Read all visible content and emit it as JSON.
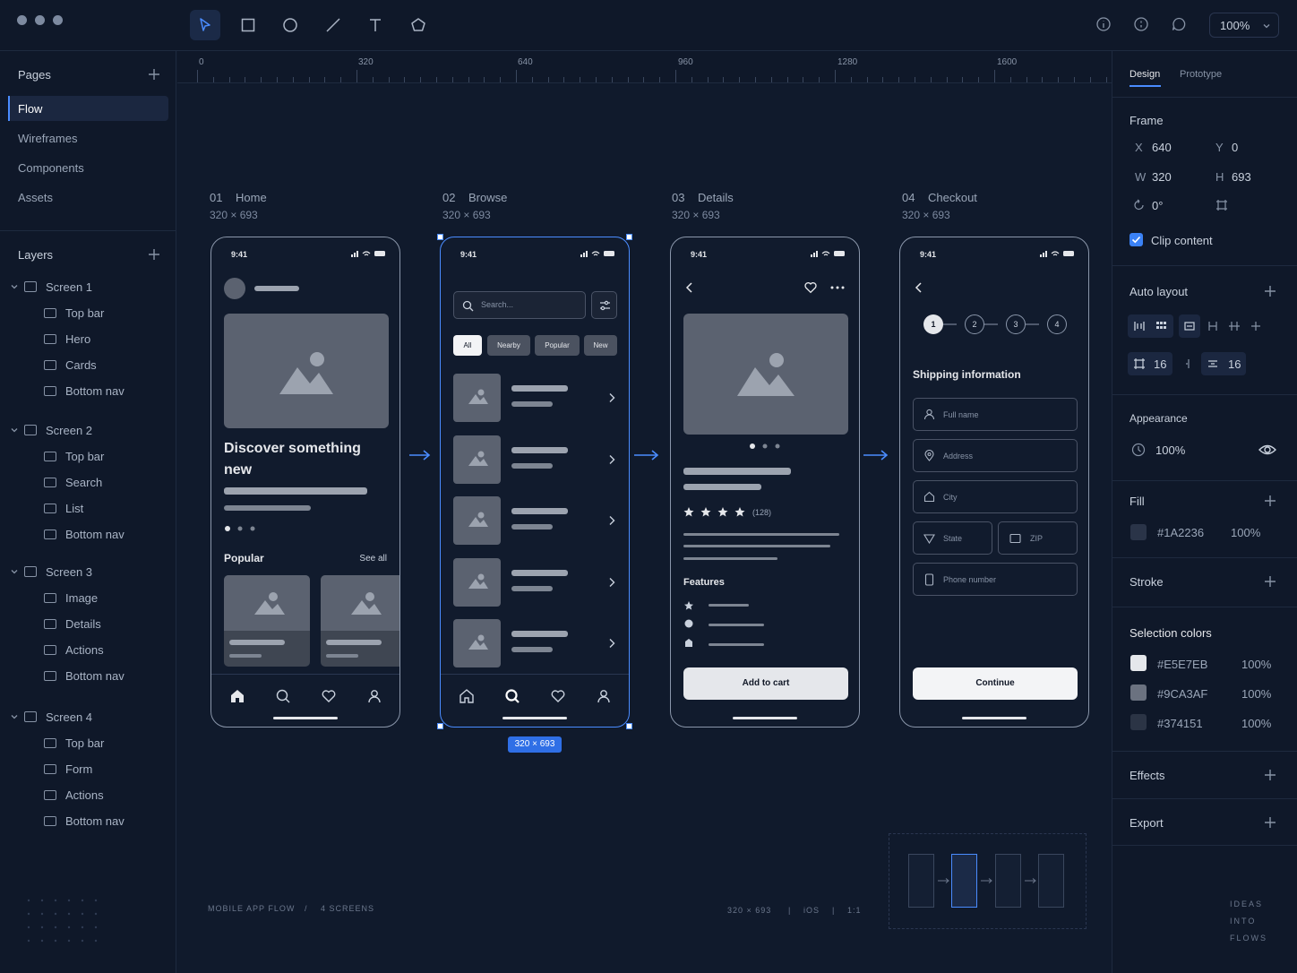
{
  "toolbar": {
    "tools": [
      "move-tool",
      "rectangle-tool",
      "ellipse-tool",
      "line-tool",
      "text-tool",
      "shape-tool"
    ],
    "zoom": "100%"
  },
  "pages": {
    "title": "Pages",
    "items": [
      "Flow",
      "Wireframes",
      "Components",
      "Assets"
    ],
    "active": "Flow"
  },
  "layers": {
    "title": "Layers",
    "screens": [
      {
        "name": "Screen 1",
        "children": [
          "Top bar",
          "Hero",
          "Cards",
          "Bottom nav"
        ]
      },
      {
        "name": "Screen 2",
        "children": [
          "Top bar",
          "Search",
          "List",
          "Bottom nav"
        ]
      },
      {
        "name": "Screen 3",
        "children": [
          "Image",
          "Details",
          "Actions",
          "Bottom nav"
        ]
      },
      {
        "name": "Screen 4",
        "children": [
          "Top bar",
          "Form",
          "Actions",
          "Bottom nav"
        ]
      }
    ]
  },
  "ruler": [
    "0",
    "320",
    "640",
    "960",
    "1280",
    "1600"
  ],
  "frames": [
    {
      "num": "01",
      "name": "Home",
      "dim": "320 × 693"
    },
    {
      "num": "02",
      "name": "Browse",
      "dim": "320 × 693"
    },
    {
      "num": "03",
      "name": "Details",
      "dim": "320 × 693"
    },
    {
      "num": "04",
      "name": "Checkout",
      "dim": "320 × 693"
    }
  ],
  "phone": {
    "time": "9:41",
    "home": {
      "headline": "Discover something new",
      "popular": "Popular",
      "see_all": "See all"
    },
    "browse": {
      "search_placeholder": "Search...",
      "chips": [
        "All",
        "Nearby",
        "Popular",
        "New"
      ],
      "selection_badge": "320 × 693"
    },
    "details": {
      "reviews": "(128)",
      "features": "Features",
      "cta": "Add to cart"
    },
    "checkout": {
      "steps": [
        "1",
        "2",
        "3",
        "4"
      ],
      "title": "Shipping information",
      "fields": {
        "full_name": "Full name",
        "address": "Address",
        "city": "City",
        "state": "State",
        "zip": "ZIP",
        "phone": "Phone number"
      },
      "cta": "Continue"
    }
  },
  "canvas_footer": {
    "left": "MOBILE APP FLOW",
    "sep": "/",
    "count": "4 SCREENS",
    "dim": "320 × 693",
    "platform": "iOS",
    "scale": "1:1",
    "bar": "|"
  },
  "brand": [
    "IDEAS",
    "INTO",
    "FLOWS"
  ],
  "inspector": {
    "tabs": [
      "Design",
      "Prototype"
    ],
    "frame": {
      "title": "Frame",
      "x_label": "X",
      "x": "640",
      "y_label": "Y",
      "y": "0",
      "w_label": "W",
      "w": "320",
      "h_label": "H",
      "h": "693",
      "rotation": "0°",
      "clip": "Clip content"
    },
    "auto_layout": {
      "title": "Auto layout",
      "padding": "16",
      "gap": "16"
    },
    "appearance": {
      "title": "Appearance",
      "opacity": "100%"
    },
    "fill": {
      "title": "Fill",
      "color": "#1A2236",
      "opacity": "100%"
    },
    "stroke": {
      "title": "Stroke"
    },
    "selection_colors": {
      "title": "Selection colors",
      "items": [
        {
          "hex": "#E5E7EB",
          "opacity": "100%"
        },
        {
          "hex": "#9CA3AF",
          "opacity": "100%"
        },
        {
          "hex": "#374151",
          "opacity": "100%"
        }
      ]
    },
    "effects": "Effects",
    "export": "Export"
  }
}
